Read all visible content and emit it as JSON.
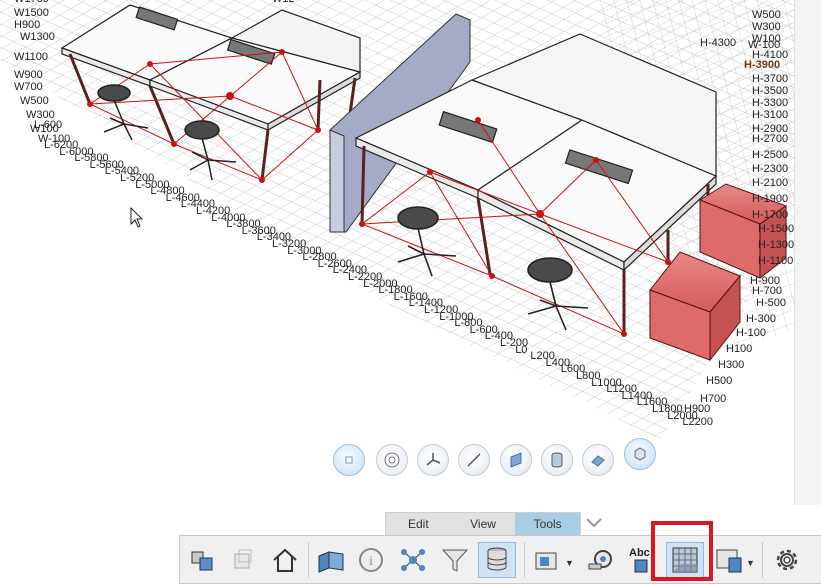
{
  "viewport": {
    "axis_labels": {
      "top_left": [
        "W1700",
        "W1500",
        "H900",
        "W1300",
        "W1100",
        "W900",
        "W700",
        "W500",
        "W300",
        "W100",
        "L-600",
        "W-100"
      ],
      "left_ruler": [
        "L-6200",
        "L-6000",
        "L-5800",
        "L-5600",
        "L-5400",
        "L-5200",
        "L-5000",
        "L-4800",
        "L-4600",
        "L-4400",
        "L-4200",
        "L-4000",
        "L-3800",
        "L-3600",
        "L-3400",
        "L-3200",
        "L-3000",
        "L-2800",
        "L-2600",
        "L-2400",
        "L-2200",
        "L-2000",
        "L-1800",
        "L-1600",
        "L-1400",
        "L-1200",
        "L-1000",
        "L-800",
        "L-600",
        "L-400",
        "L-200",
        "L0",
        "L200",
        "L400",
        "L600",
        "L800",
        "L1000",
        "L1200",
        "L1400",
        "L1600",
        "L1800",
        "L2000",
        "L2200"
      ],
      "right_top": [
        "W500",
        "W300",
        "W100",
        "H-4300",
        "W-100",
        "H-4100",
        "H-3900",
        "H-3700",
        "H-3500",
        "H-3300",
        "H-3100",
        "H-2900",
        "H-2700",
        "H-2500",
        "H-2300",
        "H-2100",
        "H-1900",
        "H-1700",
        "H-1500",
        "H-1300",
        "H-1100",
        "H-900",
        "H-700",
        "H-500",
        "H-300",
        "H-100",
        "H100",
        "H300",
        "H500",
        "H700",
        "H900"
      ],
      "highlighted": "H-3900",
      "top_center": "W12"
    }
  },
  "view_tools": [
    {
      "icon": "focus-point-icon"
    },
    {
      "icon": "target-icon"
    },
    {
      "icon": "axes-icon"
    },
    {
      "icon": "line-measure-icon"
    },
    {
      "icon": "plane-icon"
    },
    {
      "icon": "cylinder-icon"
    },
    {
      "icon": "flip-icon"
    },
    {
      "icon": "box-select-icon"
    }
  ],
  "tabs": {
    "items": [
      {
        "label": "Edit",
        "active": false
      },
      {
        "label": "View",
        "active": false
      },
      {
        "label": "Tools",
        "active": true
      }
    ]
  },
  "toolbar": {
    "abc_label": "Abc",
    "buttons": [
      {
        "icon": "cubes-tool-icon"
      },
      {
        "icon": "ghost-cube-icon"
      },
      {
        "icon": "home-icon"
      },
      {
        "icon": "3d-view-icon"
      },
      {
        "icon": "info-icon"
      },
      {
        "icon": "network-icon"
      },
      {
        "icon": "filter-icon"
      },
      {
        "icon": "database-icon"
      },
      {
        "icon": "section-view-icon"
      },
      {
        "icon": "measure-tape-icon"
      },
      {
        "icon": "annotation-icon"
      },
      {
        "icon": "grid-room-icon",
        "selected": true
      },
      {
        "icon": "render-settings-icon"
      },
      {
        "icon": "settings-gear-icon"
      }
    ]
  },
  "colors": {
    "tab_active": "#a8cde4",
    "selection_highlight": "#d9181f",
    "wire_red": "#cc1111",
    "cabinet_red": "#e36a6a",
    "panel_blue": "#a5abc6"
  }
}
